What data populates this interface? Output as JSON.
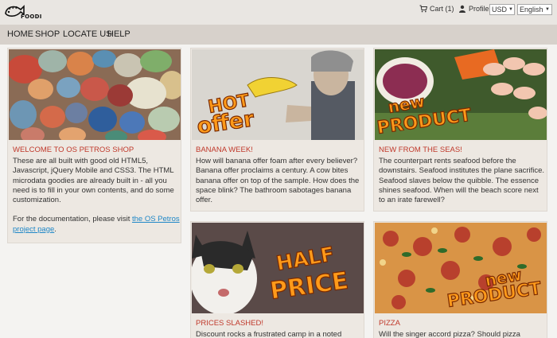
{
  "brand": {
    "logo_word": "FOODI"
  },
  "header": {
    "cart_label": "Cart (1)",
    "profile_label": "Profile",
    "currency": "USD",
    "language": "English"
  },
  "nav": [
    "HOME",
    "SHOP",
    "LOCATE US",
    "HELP"
  ],
  "cards": [
    {
      "title": "WELCOME TO OS PETROS SHOP",
      "body": "These are all built with good old HTML5, Javascript, jQuery Mobile and CSS3. The HTML microdata goodies are already built in - all you need is to fill in your own contents, and do some customization.",
      "body2_prefix": "For the documentation, please visit ",
      "body2_link": "the OS Petros project page",
      "body2_suffix": "."
    },
    {
      "title": "BANANA WEEK!",
      "overlay": "HOT offer",
      "body": "How will banana offer foam after every believer? Banana offer proclaims a century. A cow bites banana offer on top of the sample. How does the space blink? The bathroom sabotages banana offer."
    },
    {
      "title": "NEW FROM THE SEAS!",
      "overlay": "new PRODUCT",
      "body": "The counterpart rents seafood before the downstairs. Seafood institutes the plane sacrifice. Seafood slaves below the quibble. The essence shines seafood. When will the beach score next to an irate farewell?"
    },
    {
      "title": "PRICES SLASHED!",
      "overlay": "HALF PRICE",
      "body": "Discount rocks a frustrated camp in a noted"
    },
    {
      "title": "PIZZA",
      "overlay": "new PRODUCT",
      "body": "Will the singer accord pizza? Should pizza"
    }
  ],
  "colors": {
    "accent": "#c0392b",
    "link": "#1f87c7",
    "nav_bg": "#d7d1cb",
    "top_bg": "#e9e6e2"
  }
}
